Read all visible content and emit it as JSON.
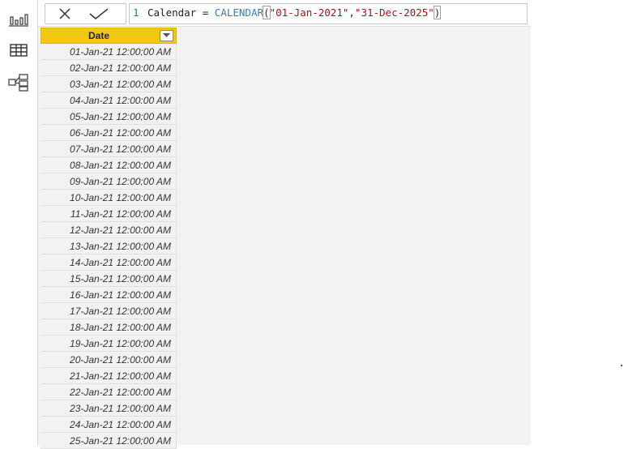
{
  "formula_bar": {
    "cancel_icon": "close-icon",
    "commit_icon": "checkmark-icon",
    "line_number": "1",
    "code": {
      "prefix": "Calendar = ",
      "function": "CALENDAR",
      "open_paren": "(",
      "arg1": "\"01-Jan-2021\"",
      "comma": ",",
      "arg2": "\"31-Dec-2025\"",
      "close_paren": ")"
    }
  },
  "left_rail": [
    {
      "name": "report-view-icon"
    },
    {
      "name": "data-view-icon"
    },
    {
      "name": "model-view-icon"
    }
  ],
  "table": {
    "column_header": "Date",
    "filter_icon": "chevron-down-icon",
    "rows": [
      "01-Jan-21 12:00:00 AM",
      "02-Jan-21 12:00:00 AM",
      "03-Jan-21 12:00:00 AM",
      "04-Jan-21 12:00:00 AM",
      "05-Jan-21 12:00:00 AM",
      "06-Jan-21 12:00:00 AM",
      "07-Jan-21 12:00:00 AM",
      "08-Jan-21 12:00:00 AM",
      "09-Jan-21 12:00:00 AM",
      "10-Jan-21 12:00:00 AM",
      "11-Jan-21 12:00:00 AM",
      "12-Jan-21 12:00:00 AM",
      "13-Jan-21 12:00:00 AM",
      "14-Jan-21 12:00:00 AM",
      "15-Jan-21 12:00:00 AM",
      "16-Jan-21 12:00:00 AM",
      "17-Jan-21 12:00:00 AM",
      "18-Jan-21 12:00:00 AM",
      "19-Jan-21 12:00:00 AM",
      "20-Jan-21 12:00:00 AM",
      "21-Jan-21 12:00:00 AM",
      "22-Jan-21 12:00:00 AM",
      "23-Jan-21 12:00:00 AM",
      "24-Jan-21 12:00:00 AM",
      "25-Jan-21 12:00:00 AM"
    ]
  },
  "colors": {
    "header_accent": "#f2c811",
    "canvas_bg": "#f3f2f1",
    "function_token": "#3b7bbf",
    "string_token": "#a31515"
  }
}
